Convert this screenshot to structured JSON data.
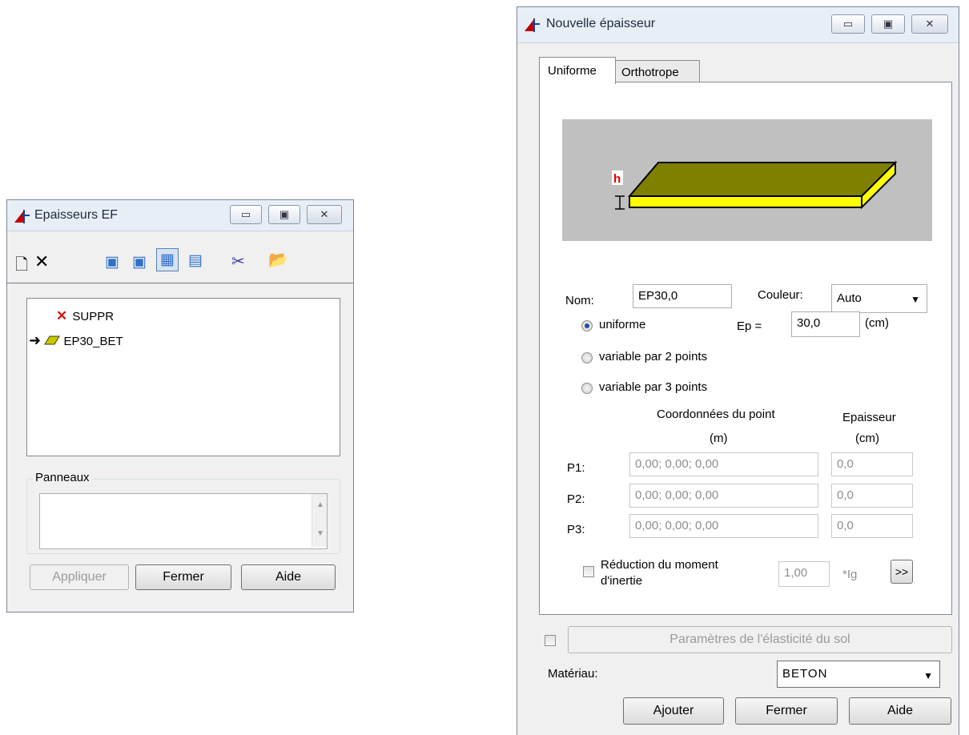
{
  "left_window": {
    "title": "Epaisseurs EF",
    "caption_buttons": {
      "minimize": "▭",
      "maximize": "▣",
      "close": "✕"
    },
    "toolbar": [
      {
        "icon": "new-document-icon",
        "glyph": "🗋"
      },
      {
        "icon": "delete-icon",
        "glyph": "✕"
      },
      {
        "icon": "large-icons-view-icon",
        "glyph": "▣"
      },
      {
        "icon": "small-icons-view-icon",
        "glyph": "▣"
      },
      {
        "icon": "list-view-icon",
        "glyph": "▦"
      },
      {
        "icon": "details-view-icon",
        "glyph": "▤"
      },
      {
        "icon": "scissors-icon",
        "glyph": "✂"
      },
      {
        "icon": "open-folder-icon",
        "glyph": "📂"
      }
    ],
    "list_items": [
      {
        "label": "SUPPR",
        "icon": "red-x-icon"
      },
      {
        "label": "EP30_BET",
        "icon": "thickness-plate-icon",
        "current": true
      }
    ],
    "panneaux_label": "Panneaux",
    "buttons": {
      "apply": "Appliquer",
      "close": "Fermer",
      "help": "Aide"
    }
  },
  "right_window": {
    "title": "Nouvelle épaisseur",
    "caption_buttons": {
      "minimize": "▭",
      "maximize": "▣",
      "close": "✕"
    },
    "tabs": [
      {
        "label": "Uniforme",
        "active": true
      },
      {
        "label": "Orthotrope",
        "active": false
      }
    ],
    "diagram_label": "h",
    "nom_label": "Nom:",
    "nom_value": "EP30,0",
    "couleur_label": "Couleur:",
    "couleur_value": "Auto",
    "radio_options": [
      "uniforme",
      "variable par 2 points",
      "variable par 3 points"
    ],
    "selected_option": "uniforme",
    "ep_label": "Ep =",
    "ep_value": "30,0",
    "ep_unit": "(cm)",
    "coord_header": "Coordonnées du point",
    "coord_unit": "(m)",
    "thickness_header": "Epaisseur",
    "thickness_unit": "(cm)",
    "points": [
      {
        "label": "P1:",
        "coords": "0,00; 0,00; 0,00",
        "thickness": "0,0"
      },
      {
        "label": "P2:",
        "coords": "0,00; 0,00; 0,00",
        "thickness": "0,0"
      },
      {
        "label": "P3:",
        "coords": "0,00; 0,00; 0,00",
        "thickness": "0,0"
      }
    ],
    "reduction_label_1": "Réduction du moment",
    "reduction_label_2": "d'inertie",
    "reduction_value": "1,00",
    "reduction_unit": "*Ig",
    "more_button": ">>",
    "soil_button": "Paramètres de l'élasticité du sol",
    "material_label": "Matériau:",
    "material_value": "BETON",
    "buttons": {
      "add": "Ajouter",
      "close": "Fermer",
      "help": "Aide"
    },
    "colors": {
      "plate_top": "#7f7f00",
      "plate_side": "#ffff00",
      "diagram_bg": "#c0c0c0"
    }
  }
}
